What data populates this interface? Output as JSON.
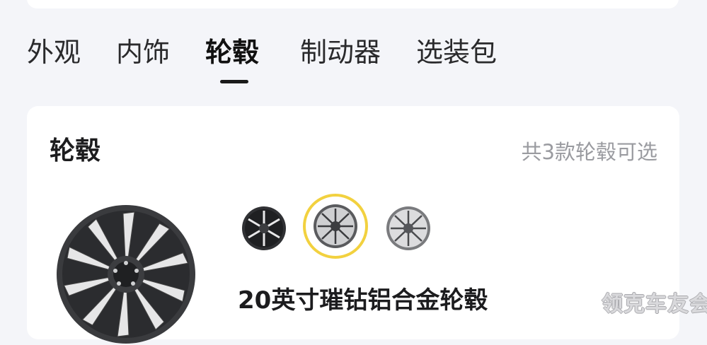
{
  "tabs": [
    {
      "label": "外观",
      "active": false
    },
    {
      "label": "内饰",
      "active": false
    },
    {
      "label": "轮毂",
      "active": true
    },
    {
      "label": "制动器",
      "active": false
    },
    {
      "label": "选装包",
      "active": false
    }
  ],
  "wheel_section": {
    "title": "轮毂",
    "count_text": "共3款轮毂可选",
    "selected_name": "20英寸璀钻铝合金轮毂",
    "options": [
      {
        "icon": "wheel-option-icon",
        "selected": false
      },
      {
        "icon": "wheel-option-icon",
        "selected": true
      },
      {
        "icon": "wheel-option-icon",
        "selected": false
      }
    ]
  },
  "watermark": "领克车友会",
  "colors": {
    "background": "#f4f5f9",
    "card": "#ffffff",
    "selected_ring": "#f2d13f",
    "muted_text": "#9a9ba0"
  }
}
